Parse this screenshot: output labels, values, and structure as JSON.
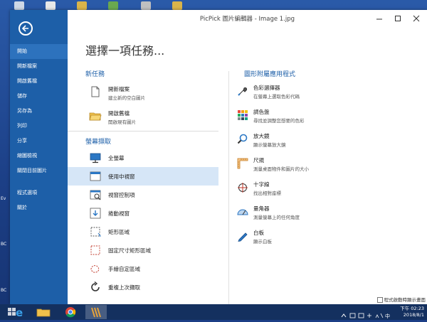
{
  "window": {
    "title": "PicPick 圖片編輯器 - Image 1.jpg"
  },
  "sidebar": {
    "items": [
      {
        "label": "開始",
        "active": true
      },
      {
        "label": "開新檔案"
      },
      {
        "label": "開啟舊檔"
      },
      {
        "label": "儲存"
      },
      {
        "label": "另存為"
      },
      {
        "label": "列印"
      },
      {
        "label": "分享"
      },
      {
        "label": "縮圖檢視"
      },
      {
        "label": "關閉目前圖片"
      },
      {
        "label": "程式選項"
      },
      {
        "label": "關於"
      }
    ]
  },
  "main": {
    "heading": "選擇一項任務...",
    "new_task": {
      "title": "新任務",
      "items": [
        {
          "title": "開新檔案",
          "desc": "建立新的空白圖片",
          "icon": "new-file-icon"
        },
        {
          "title": "開啟舊檔",
          "desc": "開啟現有圖片",
          "icon": "open-folder-icon"
        }
      ]
    },
    "capture": {
      "title": "螢幕擷取",
      "items": [
        {
          "title": "全螢幕",
          "icon": "monitor-icon"
        },
        {
          "title": "使用中視窗",
          "icon": "active-window-icon",
          "active": true
        },
        {
          "title": "視窗控制項",
          "icon": "window-control-icon"
        },
        {
          "title": "捲動視窗",
          "icon": "scroll-window-icon"
        },
        {
          "title": "矩形區域",
          "icon": "rect-region-icon"
        },
        {
          "title": "固定尺寸矩形區域",
          "icon": "fixed-region-icon"
        },
        {
          "title": "手繪自定區域",
          "icon": "freehand-icon"
        },
        {
          "title": "重複上次擷取",
          "icon": "repeat-icon"
        }
      ]
    },
    "accessories": {
      "title": "圖形附屬應用程式",
      "items": [
        {
          "title": "色彩選擇器",
          "desc": "在螢幕上選取色彩代碼",
          "icon": "eyedropper-icon"
        },
        {
          "title": "調色盤",
          "desc": "尋找並調整您想要的色彩",
          "icon": "palette-icon"
        },
        {
          "title": "放大鏡",
          "desc": "顯示螢幕放大鏡",
          "icon": "magnifier-icon"
        },
        {
          "title": "尺規",
          "desc": "測量桌面物件和圖片的大小",
          "icon": "ruler-icon"
        },
        {
          "title": "十字線",
          "desc": "找出相對座標",
          "icon": "crosshair-icon"
        },
        {
          "title": "量角器",
          "desc": "測量螢幕上的任何角度",
          "icon": "protractor-icon"
        },
        {
          "title": "白板",
          "desc": "顯示白板",
          "icon": "whiteboard-icon"
        }
      ]
    },
    "footer_check": "程式啟動時顯示畫面"
  },
  "desktop": {
    "side_labels": [
      "Ev",
      "BC",
      "BC"
    ]
  },
  "taskbar": {
    "clock_time": "下午 02:23",
    "clock_date": "2018/8/1"
  },
  "colors": {
    "sidebar": "#1d5fa8",
    "accent": "#1d5fa8",
    "active_item": "#d6e6f7"
  }
}
